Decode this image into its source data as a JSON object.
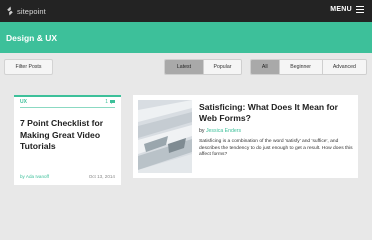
{
  "header": {
    "logo_text": "sitepoint",
    "menu_label": "MENU"
  },
  "banner": {
    "title": "Design & UX"
  },
  "filters": {
    "filter_button": "Filter Posts",
    "sort_options": [
      "Latest",
      "Popular"
    ],
    "sort_selected": "Latest",
    "level_options": [
      "All",
      "Beginner",
      "Advanced"
    ],
    "level_selected": "All"
  },
  "articles": [
    {
      "category": "UX",
      "comment_count": "1",
      "title": "7 Point Checklist for Making Great Video Tutorials",
      "author": "by Ada Ivanoff",
      "date": "Oct 13, 2014"
    },
    {
      "title": "Satisficing: What Does It Mean for Web Forms?",
      "byline_prefix": "by",
      "author": "Jessica Enders",
      "excerpt": "Satisficing is a combination of the word 'satisfy' and 'suffice', and describes the tendency to do just enough to get a result. How does this affect forms?"
    }
  ],
  "colors": {
    "accent": "#3dc09a",
    "topbar": "#232323",
    "background": "#e8e8e8"
  },
  "icons": {
    "logo": "sitepoint-logo-icon",
    "menu": "hamburger-icon",
    "comments": "comment-bubble-icon"
  }
}
